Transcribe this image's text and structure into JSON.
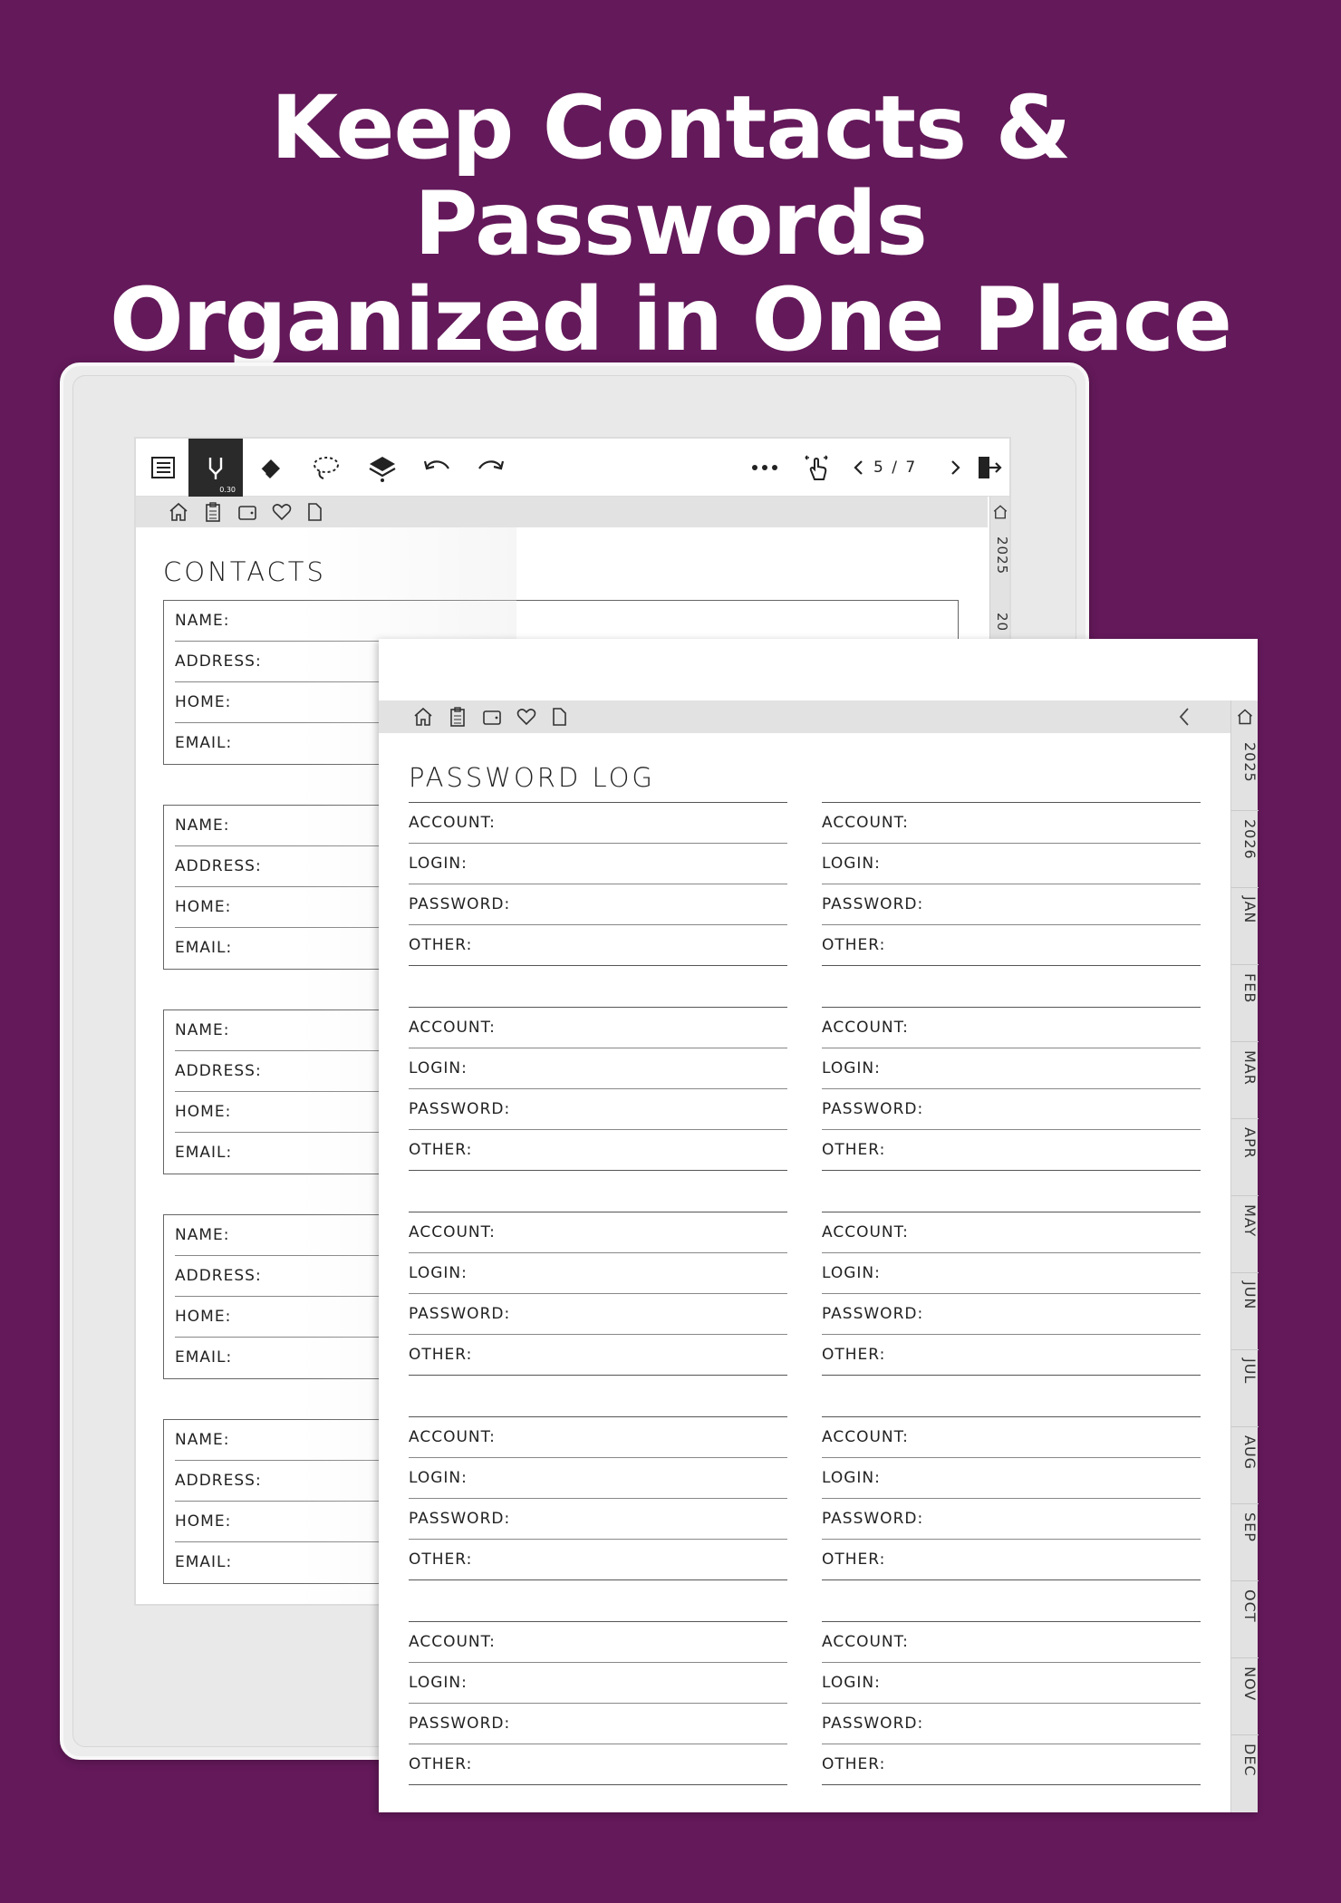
{
  "headline": {
    "line1": "Keep Contacts & Passwords",
    "line2": "Organized in One Place"
  },
  "toolbar": {
    "pen_size": "0.30",
    "pager": "5 / 7",
    "icons": [
      "menu-icon",
      "pen-icon",
      "eraser-icon",
      "lasso-icon",
      "layers-icon",
      "undo-icon",
      "redo-icon",
      "more-icon",
      "touch-icon",
      "prev-page-icon",
      "next-page-icon",
      "exit-icon"
    ]
  },
  "contacts": {
    "title": "CONTACTS",
    "labels": [
      "NAME:",
      "ADDRESS:",
      "HOME:",
      "EMAIL:"
    ],
    "side_tabs": [
      "2025",
      "20"
    ]
  },
  "password_log": {
    "title": "PASSWORD LOG",
    "labels": [
      "ACCOUNT:",
      "LOGIN:",
      "PASSWORD:",
      "OTHER:"
    ],
    "side_tabs": [
      "2025",
      "2026",
      "JAN",
      "FEB",
      "MAR",
      "APR",
      "MAY",
      "JUN",
      "JUL",
      "AUG",
      "SEP",
      "OCT",
      "NOV",
      "DEC"
    ]
  },
  "nav_icons": [
    "home-icon",
    "clipboard-icon",
    "wallet-icon",
    "heart-icon",
    "page-icon"
  ],
  "colors": {
    "background": "#64195a",
    "accent": "#2a2a2a"
  }
}
